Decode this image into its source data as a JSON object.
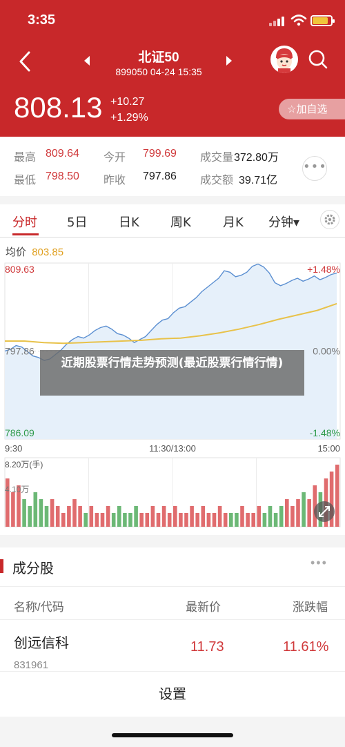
{
  "status": {
    "time": "3:35"
  },
  "header": {
    "title": "北证50",
    "subtitle": "899050 04-24 15:35",
    "price": "808.13",
    "change_abs": "+10.27",
    "change_pct": "+1.29%",
    "add_fav_label": "☆加自选"
  },
  "stats": {
    "high_label": "最高",
    "high": "809.64",
    "open_label": "今开",
    "open": "799.69",
    "volume_label": "成交量",
    "volume": "372.80万",
    "low_label": "最低",
    "low": "798.50",
    "prev_close_label": "昨收",
    "prev_close": "797.86",
    "amount_label": "成交额",
    "amount": "39.71亿",
    "more": "•••"
  },
  "tabs": [
    {
      "label": "分时",
      "active": true
    },
    {
      "label": "5日"
    },
    {
      "label": "日K"
    },
    {
      "label": "周K"
    },
    {
      "label": "月K"
    },
    {
      "label": "分钟▾"
    }
  ],
  "chart": {
    "avg_label": "均价",
    "avg_value": "803.85",
    "ytick_top": "809.63",
    "ytick_mid": "797.86",
    "ytick_bot": "786.09",
    "pct_top": "+1.48%",
    "pct_mid": "0.00%",
    "pct_bot": "-1.48%",
    "xtick_start": "9:30",
    "xtick_mid": "11:30/13:00",
    "xtick_end": "15:00",
    "vol_label": "8.20万(手)",
    "vol_mid_label": "4.10万",
    "colors": {
      "price": "#5b8fd1",
      "avg": "#e8c24a",
      "up": "#e06c6e",
      "down": "#6cb876",
      "fill": "#e6f0fa"
    }
  },
  "chart_data": {
    "type": "line",
    "ylim": [
      786.09,
      809.63
    ],
    "series": [
      {
        "name": "",
        "values": [
          797.86,
          798.1,
          798.6,
          798.4,
          797.8,
          797.2,
          797.0,
          796.6,
          796.8,
          797.4,
          798.0,
          798.8,
          799.4,
          799.8,
          799.6,
          800.0,
          800.6,
          801.0,
          801.2,
          800.8,
          800.2,
          800.0,
          799.6,
          799.0,
          799.4,
          799.8,
          800.6,
          801.4,
          802.0,
          802.2,
          803.0,
          803.6,
          803.8,
          804.4,
          805.0,
          805.8,
          806.4,
          807.0,
          807.6,
          808.6,
          808.4,
          807.8,
          808.0,
          808.4,
          809.2,
          809.5,
          809.1,
          808.3,
          807.0,
          806.6,
          806.9,
          807.3,
          807.6,
          807.2,
          807.5,
          807.9,
          807.4,
          807.7,
          808.1,
          808.3
        ]
      },
      {
        "name": "",
        "values": [
          799.2,
          799.2,
          799.0,
          798.9,
          799.0,
          799.1,
          799.2,
          799.3,
          799.5,
          799.6,
          799.9,
          800.3,
          800.8,
          801.4,
          802.1,
          802.7,
          803.3,
          804.2
        ]
      }
    ],
    "volume": [
      7,
      5,
      6,
      4,
      3,
      5,
      4,
      3,
      4,
      3,
      2,
      3,
      4,
      3,
      2,
      3,
      2,
      2,
      3,
      2,
      3,
      2,
      2,
      3,
      2,
      2,
      3,
      2,
      3,
      2,
      3,
      2,
      2,
      3,
      2,
      3,
      2,
      2,
      3,
      2,
      2,
      2,
      3,
      2,
      2,
      3,
      2,
      3,
      2,
      3,
      4,
      3,
      4,
      5,
      4,
      6,
      5,
      7,
      8,
      9
    ]
  },
  "overlay": {
    "text": "近期股票行情走势预测(最近股票行情行情)"
  },
  "components": {
    "title": "成分股",
    "more": "•••",
    "col_name": "名称/代码",
    "col_price": "最新价",
    "col_change": "涨跌幅",
    "rows": [
      {
        "name": "创远信科",
        "code": "831961",
        "price": "11.73",
        "change": "11.61%"
      }
    ]
  },
  "settings_label": "设置"
}
